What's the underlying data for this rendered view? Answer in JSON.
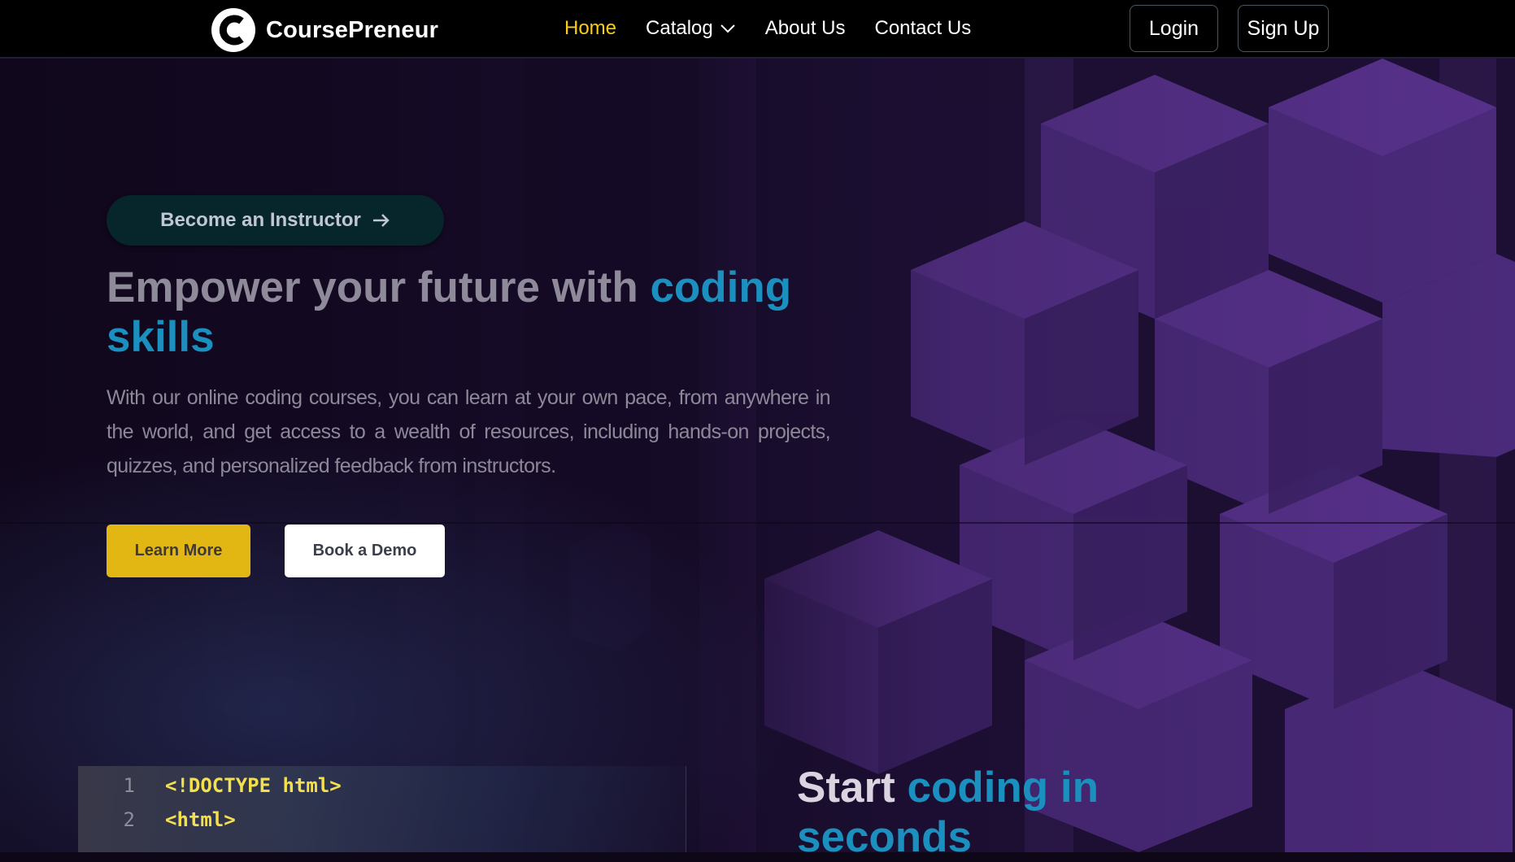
{
  "brand": {
    "name": "CoursePreneur",
    "logo_letter": "C"
  },
  "nav": {
    "links": [
      {
        "label": "Home",
        "active": true
      },
      {
        "label": "Catalog",
        "has_dropdown": true
      },
      {
        "label": "About Us"
      },
      {
        "label": "Contact Us"
      }
    ],
    "login_label": "Login",
    "signup_label": "Sign Up"
  },
  "hero": {
    "instructor_label": "Become an Instructor",
    "title_plain": "Empower your future with ",
    "title_highlight": "coding skills",
    "description": "With our online coding courses, you can learn at your own pace, from anywhere in the world, and get access to a wealth of resources, including hands-on projects, quizzes, and personalized feedback from instructors.",
    "learn_more_label": "Learn More",
    "book_demo_label": "Book a Demo"
  },
  "code_section": {
    "lines": [
      {
        "num": "1",
        "code": "<!DOCTYPE html>"
      },
      {
        "num": "2",
        "code": "<html>"
      }
    ],
    "title_plain": "Start ",
    "title_highlight": "coding in seconds"
  },
  "colors": {
    "accent_yellow": "#facc15",
    "highlight_blue": "#1b8fbd",
    "cta_yellow": "#e2b714",
    "background": "#0d0718"
  },
  "icons": {
    "logo": "coursepreneur-c-logo",
    "catalog_chevron": "chevron-down-icon",
    "instructor_arrow": "arrow-right-icon"
  }
}
